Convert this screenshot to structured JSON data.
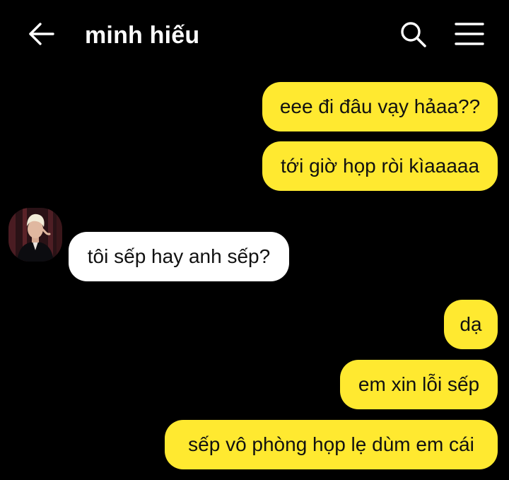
{
  "header": {
    "title": "minh hiếu",
    "back_icon": "arrow-left-icon",
    "search_icon": "search-icon",
    "menu_icon": "hamburger-menu-icon"
  },
  "colors": {
    "background": "#000000",
    "sent_bubble": "#ffe930",
    "received_bubble": "#ffffff",
    "bubble_text": "#111111",
    "header_icons": "#ffffff"
  },
  "messages": [
    {
      "sender": "me",
      "text": "eee đi đâu vạy hảaa??"
    },
    {
      "sender": "me",
      "text": "tới giờ họp ròi kìaaaaa"
    },
    {
      "sender": "minh hiếu",
      "text": "tôi sếp hay anh sếp?"
    },
    {
      "sender": "me",
      "text": "dạ"
    },
    {
      "sender": "me",
      "text": "em xin lỗi sếp"
    },
    {
      "sender": "me",
      "text": "sếp vô phòng họp lẹ dùm em cái"
    }
  ]
}
